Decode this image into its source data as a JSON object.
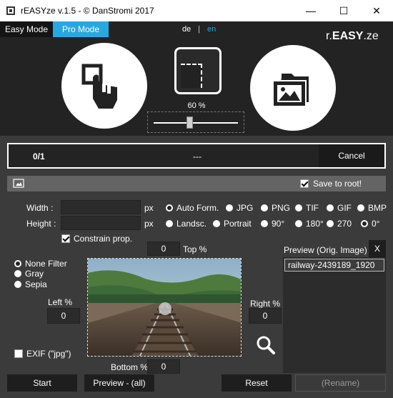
{
  "window": {
    "title": "rEASYze v.1.5 - © DanStromi 2017",
    "minimize_glyph": "—",
    "maximize_glyph": "☐",
    "close_glyph": "✕"
  },
  "modes": {
    "easy": "Easy Mode",
    "pro": "Pro Mode"
  },
  "lang": {
    "de": "de",
    "sep": "|",
    "en": "en"
  },
  "logo": {
    "prefix": "r.",
    "main": "EASY",
    "suffix": ".ze"
  },
  "zoom": {
    "label": "60 %",
    "value_percent": 60
  },
  "progress": {
    "count": "0/1",
    "message": "---",
    "cancel": "Cancel"
  },
  "save_root": {
    "label": "Save to root!",
    "checked": true
  },
  "size": {
    "width_label": "Width :",
    "height_label": "Height :",
    "unit": "px",
    "width_value": "",
    "height_value": ""
  },
  "constrain": {
    "label": "Constrain prop.",
    "checked": true
  },
  "formats": [
    "Auto Form.",
    "JPG",
    "PNG",
    "TIF",
    "GIF",
    "BMP"
  ],
  "orientation": [
    "Landsc.",
    "Portrait",
    "90°",
    "180°",
    "270",
    "0°"
  ],
  "filters": [
    "None Filter",
    "Gray",
    "Sepia"
  ],
  "crop": {
    "top_label": "Top %",
    "top": "0",
    "left_label": "Left %",
    "left": "0",
    "right_label": "Right %",
    "right": "0",
    "bottom_label": "Bottom %",
    "bottom": "0"
  },
  "exif": {
    "label": "EXIF (\"jpg\")",
    "checked": false
  },
  "preview_panel": {
    "title": "Preview (Orig. Image)",
    "close": "X",
    "filename": "railway-2439189_1920",
    "rename": "(Rename)"
  },
  "buttons": {
    "start": "Start",
    "preview_all": "Preview - (all)",
    "reset": "Reset"
  },
  "colors": {
    "accent": "#29a8e0",
    "dark": "#232323"
  }
}
